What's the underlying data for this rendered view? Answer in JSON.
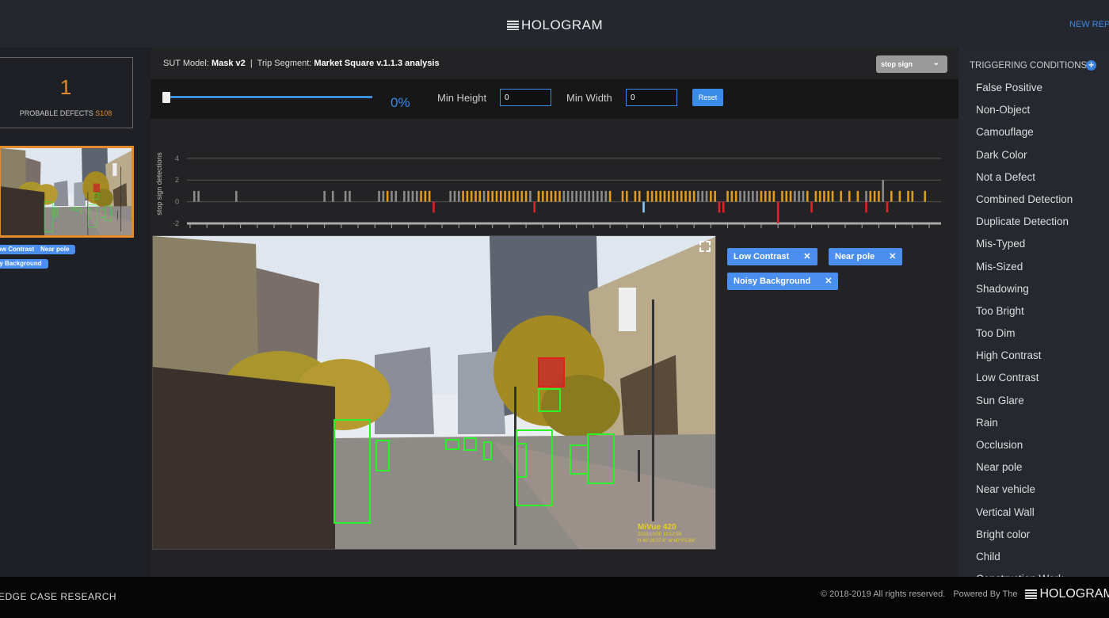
{
  "header": {
    "title": "HOLOGRAM",
    "new_report": "NEW REPORT"
  },
  "left": {
    "defect_count": "1",
    "defect_label": "PROBABLE DEFECTS",
    "defect_id": "S108",
    "thumb_tags": [
      "Low Contrast",
      "Near pole",
      "Noisy Background"
    ]
  },
  "info": {
    "model_label": "SUT Model:",
    "model": "Mask v2",
    "sep": "|",
    "segment_label": "Trip Segment:",
    "segment": "Market Square v.1.1.3 analysis"
  },
  "object_select": {
    "value": "stop sign"
  },
  "controls": {
    "slider_value": 0,
    "slider_label": "0%",
    "min_height_label": "Min Height",
    "min_height": "0",
    "min_width_label": "Min Width",
    "min_width": "0",
    "reset": "Reset"
  },
  "chart_data": {
    "type": "bar",
    "ylabel": "stop sign detections",
    "ylim": [
      -2,
      4
    ],
    "yticks": [
      -2,
      0,
      2,
      4
    ],
    "grid": true,
    "x_range": [
      "s0",
      "s177"
    ],
    "xtick_step": 4,
    "colors": {
      "gray": "#8a8a8a",
      "orange": "#e09a1e",
      "red": "#e0222a",
      "blue": "#8ec8f0"
    },
    "gray": [
      [
        1,
        1
      ],
      [
        2,
        1
      ],
      [
        11,
        1
      ],
      [
        32,
        1
      ],
      [
        34,
        1
      ],
      [
        37,
        1
      ],
      [
        38,
        1
      ],
      [
        45,
        1
      ],
      [
        46,
        1
      ],
      [
        48,
        1
      ],
      [
        49,
        1
      ],
      [
        51,
        1
      ],
      [
        52,
        1
      ],
      [
        53,
        1
      ],
      [
        54,
        1
      ],
      [
        62,
        1
      ],
      [
        63,
        1
      ],
      [
        64,
        1
      ],
      [
        70,
        1
      ],
      [
        81,
        1
      ],
      [
        89,
        1
      ],
      [
        90,
        1
      ],
      [
        91,
        1
      ],
      [
        92,
        1
      ],
      [
        93,
        1
      ],
      [
        94,
        1
      ],
      [
        95,
        1
      ],
      [
        96,
        1
      ],
      [
        97,
        1
      ],
      [
        98,
        1
      ],
      [
        99,
        1
      ],
      [
        121,
        1
      ],
      [
        122,
        1
      ],
      [
        123,
        1
      ],
      [
        131,
        1
      ],
      [
        132,
        1
      ],
      [
        133,
        1
      ],
      [
        134,
        1
      ],
      [
        135,
        1
      ],
      [
        144,
        1
      ],
      [
        145,
        1
      ],
      [
        146,
        1
      ],
      [
        161,
        1
      ],
      [
        165,
        2
      ]
    ],
    "orange": [
      [
        47,
        1
      ],
      [
        55,
        1
      ],
      [
        56,
        1
      ],
      [
        57,
        1
      ],
      [
        65,
        1
      ],
      [
        66,
        1
      ],
      [
        67,
        1
      ],
      [
        68,
        1
      ],
      [
        69,
        1
      ],
      [
        71,
        1
      ],
      [
        72,
        1
      ],
      [
        73,
        1
      ],
      [
        74,
        1
      ],
      [
        75,
        1
      ],
      [
        76,
        1
      ],
      [
        77,
        1
      ],
      [
        78,
        1
      ],
      [
        79,
        1
      ],
      [
        80,
        1
      ],
      [
        83,
        1
      ],
      [
        84,
        1
      ],
      [
        85,
        1
      ],
      [
        86,
        1
      ],
      [
        87,
        1
      ],
      [
        88,
        1
      ],
      [
        100,
        1
      ],
      [
        103,
        1
      ],
      [
        104,
        1
      ],
      [
        106,
        1
      ],
      [
        107,
        1
      ],
      [
        109,
        1
      ],
      [
        110,
        1
      ],
      [
        111,
        1
      ],
      [
        112,
        1
      ],
      [
        113,
        1
      ],
      [
        114,
        1
      ],
      [
        115,
        1
      ],
      [
        116,
        1
      ],
      [
        117,
        1
      ],
      [
        118,
        1
      ],
      [
        119,
        1
      ],
      [
        120,
        1
      ],
      [
        124,
        1
      ],
      [
        125,
        1
      ],
      [
        128,
        1
      ],
      [
        129,
        1
      ],
      [
        130,
        1
      ],
      [
        136,
        1
      ],
      [
        137,
        1
      ],
      [
        138,
        1
      ],
      [
        139,
        1
      ],
      [
        141,
        1
      ],
      [
        142,
        1
      ],
      [
        143,
        1
      ],
      [
        147,
        1
      ],
      [
        149,
        1
      ],
      [
        150,
        1
      ],
      [
        151,
        1
      ],
      [
        152,
        1
      ],
      [
        153,
        1
      ],
      [
        155,
        1
      ],
      [
        157,
        1
      ],
      [
        159,
        1
      ],
      [
        162,
        1
      ],
      [
        163,
        1
      ],
      [
        164,
        1
      ],
      [
        167,
        1
      ],
      [
        169,
        1
      ],
      [
        171,
        1
      ],
      [
        172,
        1
      ],
      [
        175,
        1
      ]
    ],
    "red": [
      [
        58,
        -1
      ],
      [
        82,
        -1
      ],
      [
        126,
        -1
      ],
      [
        127,
        -1
      ],
      [
        140,
        -2
      ],
      [
        148,
        -1
      ],
      [
        161,
        -1
      ],
      [
        166,
        -1
      ]
    ],
    "blue": [
      [
        108,
        -1
      ]
    ]
  },
  "image_tags": [
    "Low Contrast",
    "Near pole",
    "Noisy Background"
  ],
  "image_overlay": {
    "line1": "MiVue 420",
    "line2": "2018/10/30 13:12:59",
    "line3": "N 40°26'27.8\"  W 80°0'5.86\""
  },
  "triggering": {
    "title": "TRIGGERING CONDITIONS",
    "items": [
      "False Positive",
      "Non-Object",
      "Camouflage",
      "Dark Color",
      "Not a Defect",
      "Combined Detection",
      "Duplicate Detection",
      "Mis-Typed",
      "Mis-Sized",
      "Shadowing",
      "Too Bright",
      "Too Dim",
      "High Contrast",
      "Low Contrast",
      "Sun Glare",
      "Rain",
      "Occlusion",
      "Near pole",
      "Near vehicle",
      "Vertical Wall",
      "Bright color",
      "Child",
      "Construction Work"
    ]
  },
  "footer": {
    "company": "EDGE CASE RESEARCH",
    "copyright": "© 2018-2019 All rights reserved.",
    "powered": "Powered By The",
    "logo": "HOLOGRAM"
  }
}
